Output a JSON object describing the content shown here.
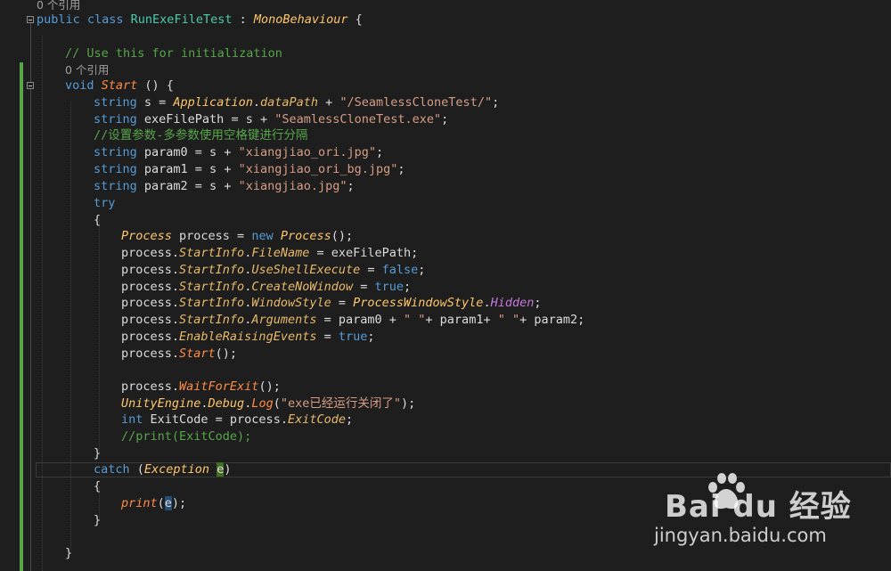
{
  "editor": {
    "language": "C#",
    "colors": {
      "background": "#1e1e1e",
      "keyword": "#569cd6",
      "type": "#ffc66d",
      "method": "#ff8c45",
      "string": "#d69d85",
      "comment": "#57a64a",
      "enum_member": "#c678dd",
      "change_bar": "#57a64a"
    },
    "reference_label": "0 个引用",
    "lines": {
      "l01": {
        "ref": "0 个引用"
      },
      "l02": {
        "kw": "public class ",
        "name": "RunExeFileTest",
        "colon": " : ",
        "base": "MonoBehaviour",
        "brace": " {"
      },
      "l04": {
        "comment": "// Use this for initialization"
      },
      "l05": {
        "ref": "0 个引用"
      },
      "l06": {
        "kw": "void ",
        "name": "Start",
        "rest": " () {"
      },
      "l07": {
        "kw": "string",
        "a": " s = ",
        "cls": "Application",
        "dot": ".",
        "prop": "dataPath",
        "b": " + ",
        "str": "\"/SeamlessCloneTest/\"",
        "end": ";"
      },
      "l08": {
        "kw": "string",
        "a": " exeFilePath = s + ",
        "str": "\"SeamlessCloneTest.exe\"",
        "end": ";"
      },
      "l09": {
        "comment": "//设置参数-多参数使用空格键进行分隔"
      },
      "l10": {
        "kw": "string",
        "a": " param0 = s + ",
        "str": "\"xiangjiao_ori.jpg\"",
        "end": ";"
      },
      "l11": {
        "kw": "string",
        "a": " param1 = s + ",
        "str": "\"xiangjiao_ori_bg.jpg\"",
        "end": ";"
      },
      "l12": {
        "kw": "string",
        "a": " param2 = s + ",
        "str": "\"xiangjiao.jpg\"",
        "end": ";"
      },
      "l13": {
        "kw": "try"
      },
      "l14": {
        "text": "{"
      },
      "l15": {
        "t1": "Process",
        "a": " process = ",
        "kw": "new",
        "sp": " ",
        "t2": "Process",
        "end": "();"
      },
      "l16": {
        "a": "process.",
        "p1": "StartInfo",
        "dot": ".",
        "p2": "FileName",
        "end": " = exeFilePath;"
      },
      "l17": {
        "a": "process.",
        "p1": "StartInfo",
        "dot": ".",
        "p2": "UseShellExecute",
        "eq": " = ",
        "kw": "false",
        "end": ";"
      },
      "l18": {
        "a": "process.",
        "p1": "StartInfo",
        "dot": ".",
        "p2": "CreateNoWindow",
        "eq": " = ",
        "kw": "true",
        "end": ";"
      },
      "l19": {
        "a": "process.",
        "p1": "StartInfo",
        "dot": ".",
        "p2": "WindowStyle",
        "eq": " = ",
        "t": "ProcessWindowStyle",
        "dot2": ".",
        "em": "Hidden",
        "end": ";"
      },
      "l20": {
        "a": "process.",
        "p1": "StartInfo",
        "dot": ".",
        "p2": "Arguments",
        "b": " = param0 + ",
        "s1": "\" \"",
        "c": "+ param1+ ",
        "s2": "\" \"",
        "d": "+ param2;"
      },
      "l21": {
        "a": "process.",
        "p": "EnableRaisingEvents",
        "eq": " = ",
        "kw": "true",
        "end": ";"
      },
      "l22": {
        "a": "process.",
        "m": "Start",
        "end": "();"
      },
      "l24": {
        "a": "process.",
        "m": "WaitForExit",
        "end": "();"
      },
      "l25": {
        "t": "UnityEngine",
        "d1": ".",
        "t2": "Debug",
        "d2": ".",
        "m": "Log",
        "o": "(",
        "str": "\"exe已经运行关闭了\"",
        "end": ");"
      },
      "l26": {
        "kw": "int",
        "a": " ExitCode = process.",
        "p": "ExitCode",
        "end": ";"
      },
      "l27": {
        "comment": "//print(ExitCode);"
      },
      "l28": {
        "text": "}"
      },
      "l29": {
        "kw": "catch",
        "a": " (",
        "t": "Exception",
        "sp": " ",
        "v": "e",
        "end": ")"
      },
      "l30": {
        "text": "{"
      },
      "l31": {
        "m": "print",
        "o": "(",
        "v": "e",
        "end": ");"
      },
      "l32": {
        "text": "}"
      },
      "l34": {
        "text": "}"
      }
    }
  },
  "watermark": {
    "brand": "Bai du 经验",
    "url": "jingyan.baidu.com",
    "logo": "baidu-paw-logo"
  }
}
